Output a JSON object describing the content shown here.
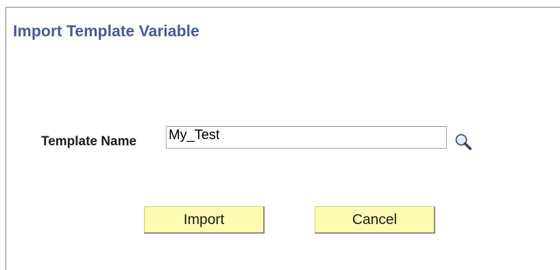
{
  "page": {
    "title": "Import Template Variable"
  },
  "form": {
    "template_name_label": "Template Name",
    "template_name_value": "My_Test",
    "lookup_icon": "magnifier-lookup-icon"
  },
  "actions": {
    "import_label": "Import",
    "cancel_label": "Cancel"
  },
  "colors": {
    "title": "#4a5a94",
    "button_bg": "#fdfbb1",
    "border": "#7f7f7f"
  }
}
